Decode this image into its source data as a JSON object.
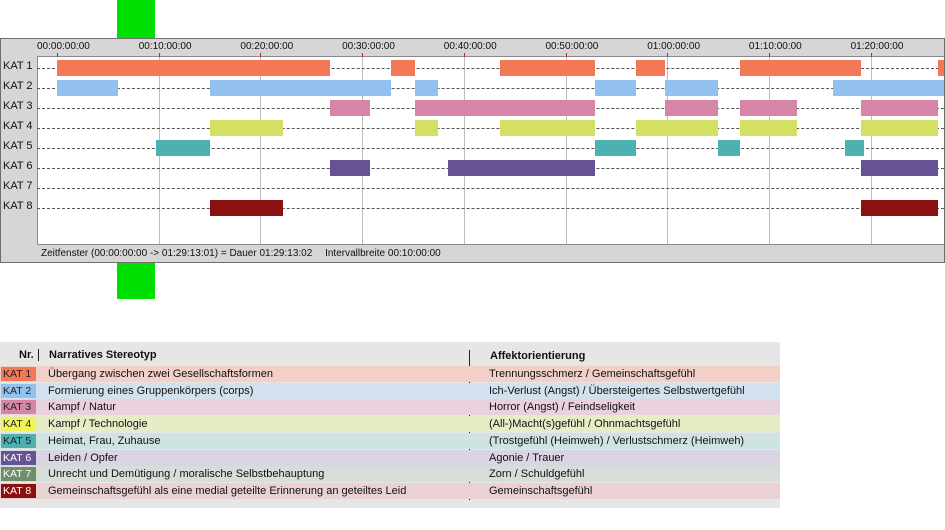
{
  "timeline": {
    "ticks": [
      "00:00:00:00",
      "00:10:00:00",
      "00:20:00:00",
      "00:30:00:00",
      "00:40:00:00",
      "00:50:00:00",
      "01:00:00:00",
      "01:10:00:00",
      "01:20:00:00"
    ],
    "rows": [
      "KAT 1",
      "KAT 2",
      "KAT 3",
      "KAT 4",
      "KAT 5",
      "KAT 6",
      "KAT 7",
      "KAT 8"
    ],
    "status": {
      "window": "Zeitfenster (00:00:00:00 -> 01:29:13:01) = Dauer 01:29:13:02",
      "interval": "Intervallbreite 00:10:00:00"
    }
  },
  "legend": {
    "head_nr": "Nr.",
    "head_stereotyp": "Narratives Stereotyp",
    "head_affekt": "Affektorientierung",
    "items": [
      {
        "tag": "KAT 1",
        "stereotyp": "Übergang zwischen zwei Gesellschaftsformen",
        "affekt": "Trennungsschmerz / Gemeinschaftsgefühl"
      },
      {
        "tag": "KAT 2",
        "stereotyp": "Formierung eines Gruppenkörpers (corps)",
        "affekt": "Ich-Verlust (Angst) / Übersteigertes Selbstwertgefühl"
      },
      {
        "tag": "KAT 3",
        "stereotyp": "Kampf / Natur",
        "affekt": "Horror (Angst) / Feindseligkeit"
      },
      {
        "tag": "KAT 4",
        "stereotyp": "Kampf / Technologie",
        "affekt": "(All-)Macht(s)gefühl / Ohnmachtsgefühl"
      },
      {
        "tag": "KAT 5",
        "stereotyp": "Heimat, Frau, Zuhause",
        "affekt": "(Trostgefühl (Heimweh) / Verlustschmerz (Heimweh)"
      },
      {
        "tag": "KAT 6",
        "stereotyp": "Leiden / Opfer",
        "affekt": "Agonie / Trauer"
      },
      {
        "tag": "KAT 7",
        "stereotyp": "Unrecht und Demütigung / moralische Selbstbehauptung",
        "affekt": "Zorn / Schuldgefühl"
      },
      {
        "tag": "KAT 8",
        "stereotyp": "Gemeinschaftsgefühl als eine medial geteilte Erinnerung an geteiltes Leid",
        "affekt": "Gemeinschaftsgefühl"
      }
    ]
  },
  "colors": {
    "kat": [
      "#f47857",
      "#92c1f0",
      "#d585a8",
      "#d3e063",
      "#4fb0b0",
      "#655394",
      "#6e8e6e",
      "#8b1010"
    ],
    "legend_bg": [
      "#f2d0c7",
      "#d3e1ef",
      "#e9d2dd",
      "#e7ebc6",
      "#cfe3e2",
      "#d9d5e4",
      "#d8ddd8",
      "#ead2d2"
    ],
    "legend_tag": [
      "#f47857",
      "#92c1f0",
      "#d585a8",
      "#f2f25a",
      "#4fb0b0",
      "#655394",
      "#6e8e6e",
      "#8b1010"
    ],
    "marker": "#00e000"
  },
  "segments_minutes": [
    [
      [
        0,
        26.8
      ],
      [
        32.8,
        35.2
      ],
      [
        43.6,
        52.9
      ],
      [
        56.9,
        59.8
      ],
      [
        67.2,
        79.1
      ],
      [
        86.6,
        89.3
      ]
    ],
    [
      [
        0,
        6
      ],
      [
        15,
        32.8
      ],
      [
        35.2,
        37.5
      ],
      [
        52.9,
        56.9
      ],
      [
        59.8,
        65
      ],
      [
        76.3,
        89.3
      ]
    ],
    [
      [
        26.8,
        30.8
      ],
      [
        35.2,
        52.9
      ],
      [
        59.8,
        65
      ],
      [
        67.2,
        72.8
      ],
      [
        79.1,
        86.6
      ]
    ],
    [
      [
        15,
        22.2
      ],
      [
        35.2,
        37.5
      ],
      [
        43.6,
        52.9
      ],
      [
        56.9,
        65
      ],
      [
        67.2,
        72.8
      ],
      [
        79.1,
        86.6
      ]
    ],
    [
      [
        9.7,
        15
      ],
      [
        52.9,
        56.9
      ],
      [
        65,
        67.2
      ],
      [
        77.5,
        79.4
      ]
    ],
    [
      [
        26.8,
        30.8
      ],
      [
        38.4,
        52.9
      ],
      [
        79.1,
        86.6
      ]
    ],
    [],
    [
      [
        15,
        22.2
      ],
      [
        79.1,
        86.6
      ]
    ]
  ]
}
